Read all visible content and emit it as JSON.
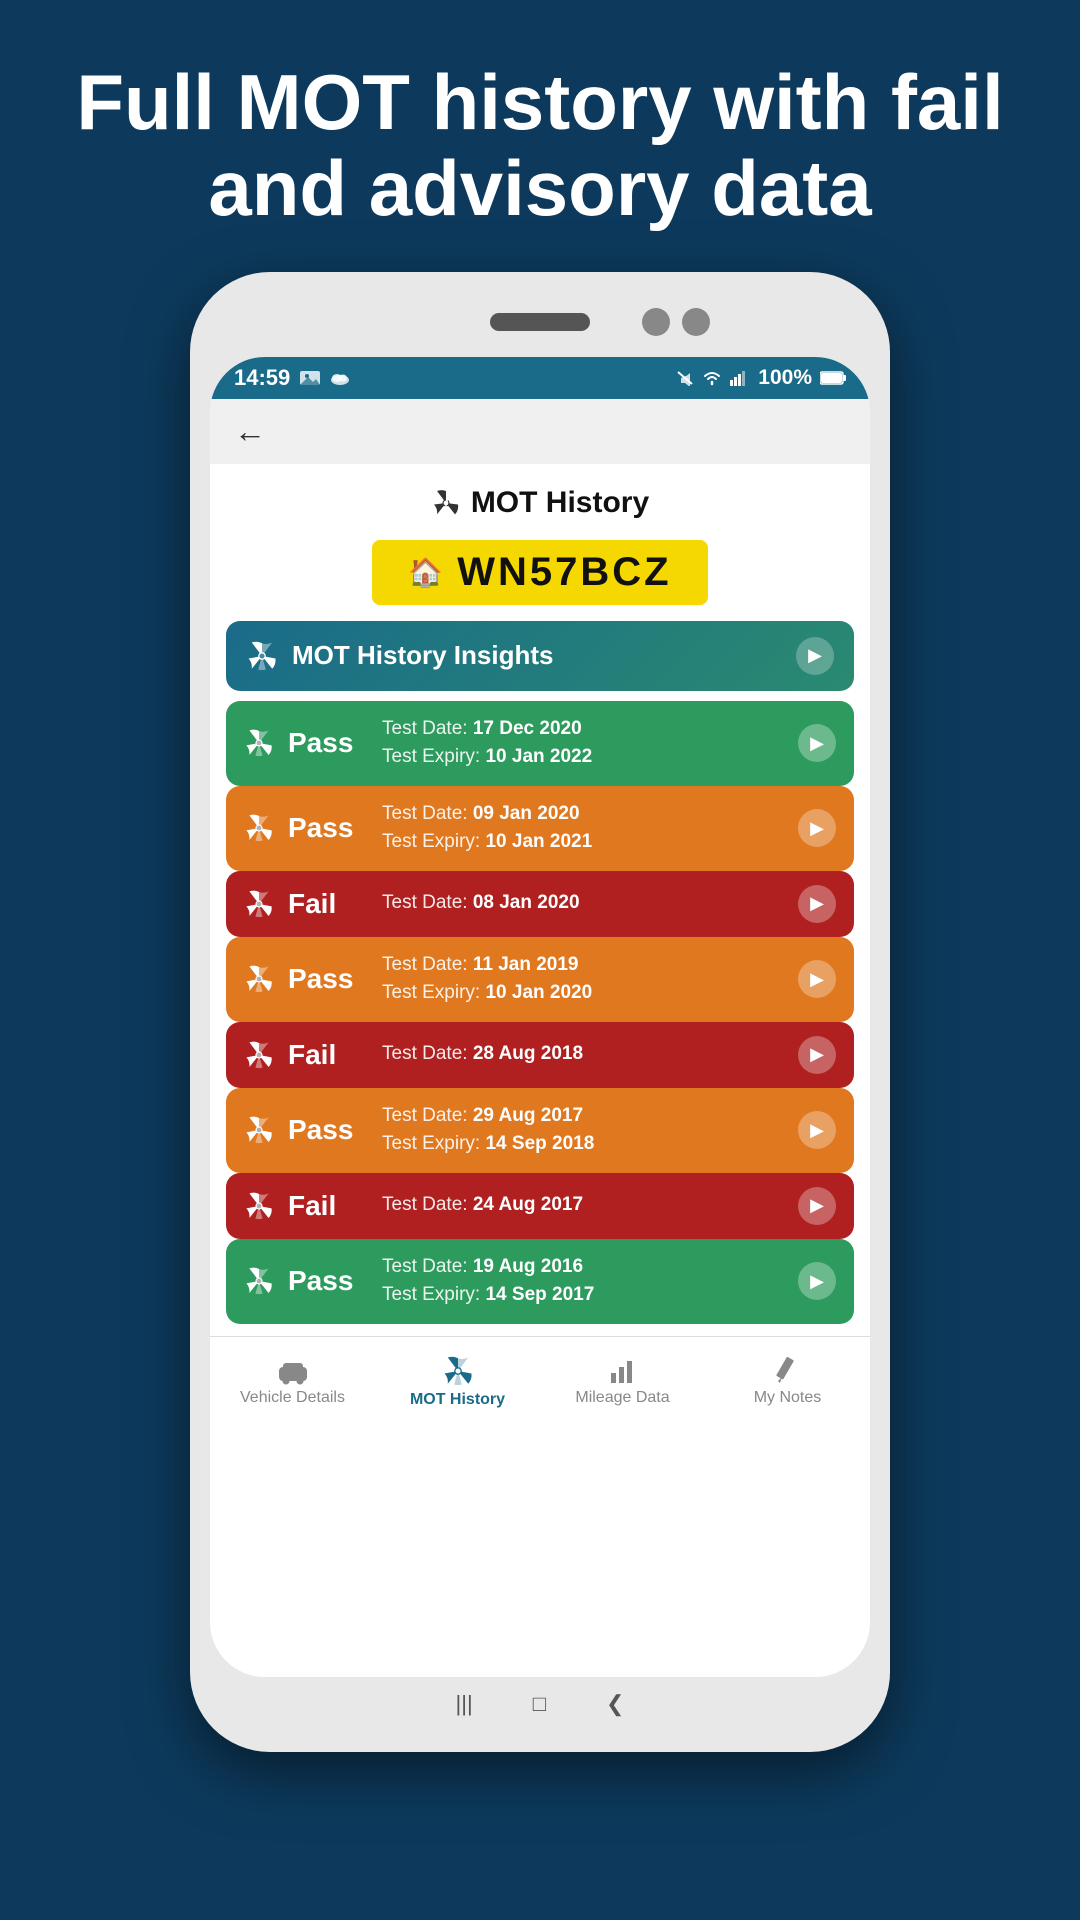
{
  "page": {
    "headline": "Full MOT history with fail and advisory data"
  },
  "status_bar": {
    "time": "14:59",
    "battery": "100%"
  },
  "header": {
    "page_title": "MOT History",
    "plate": "WN57BCZ"
  },
  "insights": {
    "label": "MOT History Insights"
  },
  "mot_records": [
    {
      "status": "Pass",
      "color": "pass-green",
      "test_date_label": "Test Date:",
      "test_date": "17 Dec 2020",
      "expiry_label": "Test Expiry:",
      "expiry": "10 Jan 2022",
      "has_expiry": true
    },
    {
      "status": "Pass",
      "color": "pass-orange",
      "test_date_label": "Test Date:",
      "test_date": "09 Jan 2020",
      "expiry_label": "Test Expiry:",
      "expiry": "10 Jan 2021",
      "has_expiry": true
    },
    {
      "status": "Fail",
      "color": "fail-red",
      "test_date_label": "Test Date:",
      "test_date": "08 Jan 2020",
      "has_expiry": false
    },
    {
      "status": "Pass",
      "color": "pass-orange",
      "test_date_label": "Test Date:",
      "test_date": "11 Jan 2019",
      "expiry_label": "Test Expiry:",
      "expiry": "10 Jan 2020",
      "has_expiry": true
    },
    {
      "status": "Fail",
      "color": "fail-red",
      "test_date_label": "Test Date:",
      "test_date": "28 Aug 2018",
      "has_expiry": false
    },
    {
      "status": "Pass",
      "color": "pass-orange",
      "test_date_label": "Test Date:",
      "test_date": "29 Aug 2017",
      "expiry_label": "Test Expiry:",
      "expiry": "14 Sep 2018",
      "has_expiry": true
    },
    {
      "status": "Fail",
      "color": "fail-red",
      "test_date_label": "Test Date:",
      "test_date": "24 Aug 2017",
      "has_expiry": false
    },
    {
      "status": "Pass",
      "color": "pass-green",
      "test_date_label": "Test Date:",
      "test_date": "19 Aug 2016",
      "expiry_label": "Test Expiry:",
      "expiry": "14 Sep 2017",
      "has_expiry": true
    }
  ],
  "bottom_nav": {
    "items": [
      {
        "id": "vehicle-details",
        "label": "Vehicle Details",
        "active": false
      },
      {
        "id": "mot-history",
        "label": "MOT History",
        "active": true
      },
      {
        "id": "mileage-data",
        "label": "Mileage Data",
        "active": false
      },
      {
        "id": "my-notes",
        "label": "My Notes",
        "active": false
      }
    ]
  }
}
